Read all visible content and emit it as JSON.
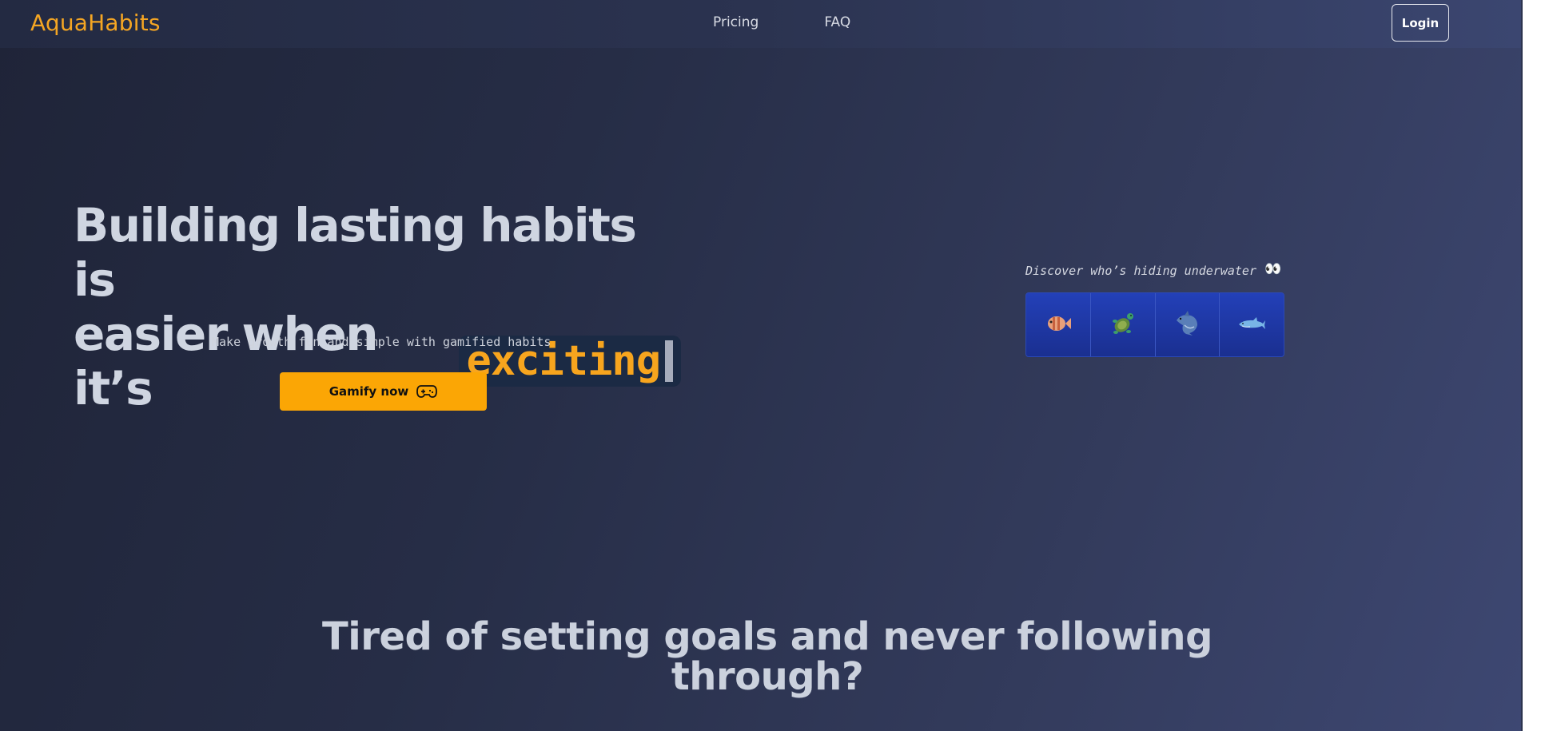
{
  "brand": {
    "name": "AquaHabits",
    "color": "#f5a623"
  },
  "nav": {
    "links": [
      {
        "label": "Pricing"
      },
      {
        "label": "FAQ"
      }
    ],
    "login_label": "Login"
  },
  "hero": {
    "title_line1": "Building lasting habits is",
    "title_line2_prefix": "easier when it’s",
    "typed_word": "exciting",
    "subtitle": "Make growth fun and simple with gamified habits",
    "cta_label": "Gamify now",
    "cta_icon": "gamepad-icon",
    "accent_color": "#fba605"
  },
  "discover": {
    "label": "Discover who’s hiding underwater",
    "emoji": "👀",
    "creatures": [
      {
        "name": "fish-icon"
      },
      {
        "name": "turtle-icon"
      },
      {
        "name": "dolphin-icon"
      },
      {
        "name": "shark-icon"
      }
    ]
  },
  "problem_section": {
    "title": "Tired of setting goals and never following through?"
  }
}
